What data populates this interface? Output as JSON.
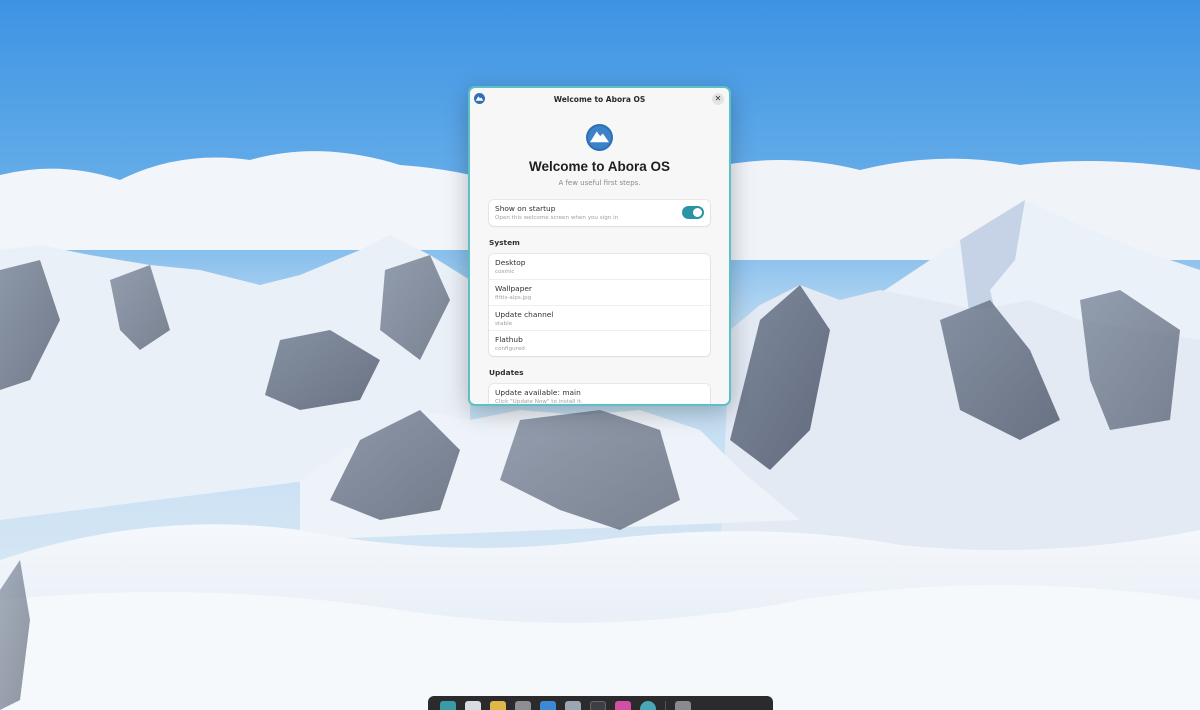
{
  "window": {
    "title": "Welcome to Abora OS",
    "close_glyph": "✕",
    "app_icon": "abora-logo-icon"
  },
  "hero": {
    "heading": "Welcome to Abora OS",
    "subtitle": "A few useful first steps."
  },
  "startup": {
    "label": "Show on startup",
    "description": "Open this welcome screen when you sign in",
    "enabled": true,
    "toggle_color": "#2a93a7"
  },
  "system": {
    "section_title": "System",
    "items": [
      {
        "label": "Desktop",
        "value": "cosmic"
      },
      {
        "label": "Wallpaper",
        "value": "fittis-alps.jpg"
      },
      {
        "label": "Update channel",
        "value": "stable"
      },
      {
        "label": "Flathub",
        "value": "configured"
      }
    ]
  },
  "updates": {
    "section_title": "Updates",
    "items": [
      {
        "label": "Update available: main",
        "value": "Click \"Update Now\" to install it."
      }
    ]
  },
  "dock": {
    "items": [
      {
        "name": "dock-launcher-icon",
        "color": "#3a9aa8"
      },
      {
        "name": "dock-workspaces-icon",
        "color": "#d9dde3"
      },
      {
        "name": "dock-apps-grid-icon",
        "color": "#e0b84a"
      },
      {
        "name": "dock-files-icon",
        "color": "#8e8e92"
      },
      {
        "name": "dock-folder-icon",
        "color": "#3b8ad6"
      },
      {
        "name": "dock-editor-icon",
        "color": "#9aa6b2"
      },
      {
        "name": "dock-terminal-icon",
        "color": "#3c3f46"
      },
      {
        "name": "dock-store-icon",
        "color": "#d14fa4"
      },
      {
        "name": "dock-settings-icon",
        "color": "#4aa7b8"
      },
      {
        "name": "dock-trash-icon",
        "color": "#8a8a8e"
      }
    ]
  },
  "colors": {
    "window_border": "#5cc0c4",
    "window_bg": "#f7f7f8",
    "accent": "#2a93a7"
  }
}
